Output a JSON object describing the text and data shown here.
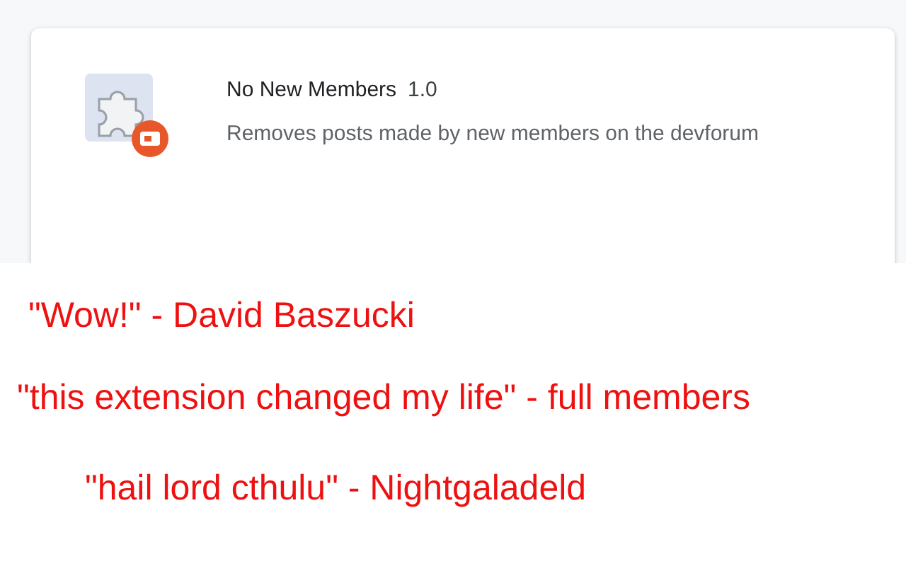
{
  "extension": {
    "name": "No New Members",
    "version": "1.0",
    "description": "Removes posts made by new members on the devforum"
  },
  "quotes": [
    {
      "text": "\"Wow!\" - David Baszucki"
    },
    {
      "text": "\"this extension changed my life\" - full members"
    },
    {
      "text": "\"hail lord cthulu\" - Nightgaladeld"
    }
  ]
}
